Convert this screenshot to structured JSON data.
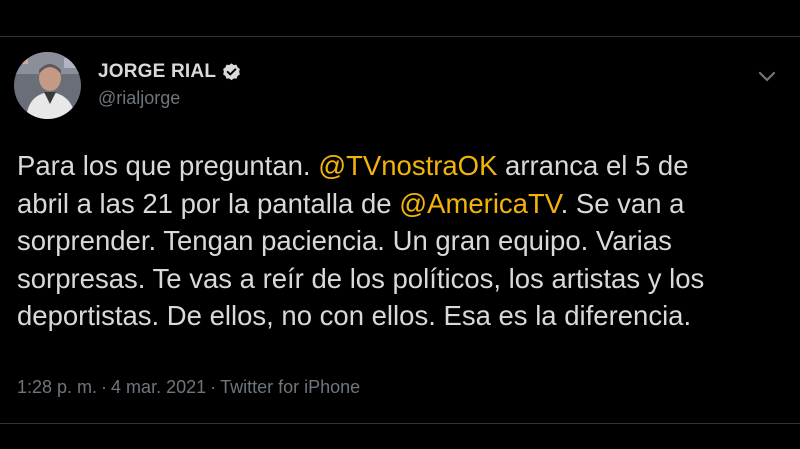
{
  "colors": {
    "background": "#000000",
    "text": "#d9d9d9",
    "muted": "#6e767d",
    "mention": "#f2b40b",
    "verified_badge": "#d9d9d9"
  },
  "tweet": {
    "author": {
      "display_name": "JORGE RIAL",
      "handle": "@rialjorge",
      "verified": true,
      "avatar_icon": "avatar"
    },
    "menu_icon": "chevron-down-icon",
    "text_lines": [
      {
        "before": "Para los que preguntan. ",
        "mention": "@TVnostraOK",
        "after": " arranca el 5 de"
      },
      {
        "before": "abril a las 21 por la pantalla de ",
        "mention": "@AmericaTV",
        "after": ". Se van a"
      },
      {
        "before": "sorprender. Tengan paciencia. Un gran equipo. Varias",
        "mention": "",
        "after": ""
      },
      {
        "before": "sorpresas. Te vas a reír de los políticos, los artistas y los",
        "mention": "",
        "after": ""
      },
      {
        "before": "deportistas. De ellos, no con ellos. Esa es la diferencia.",
        "mention": "",
        "after": ""
      }
    ],
    "time": "1:28 p. m.",
    "separator": "·",
    "date": "4 mar. 2021",
    "source": "Twitter for iPhone"
  }
}
